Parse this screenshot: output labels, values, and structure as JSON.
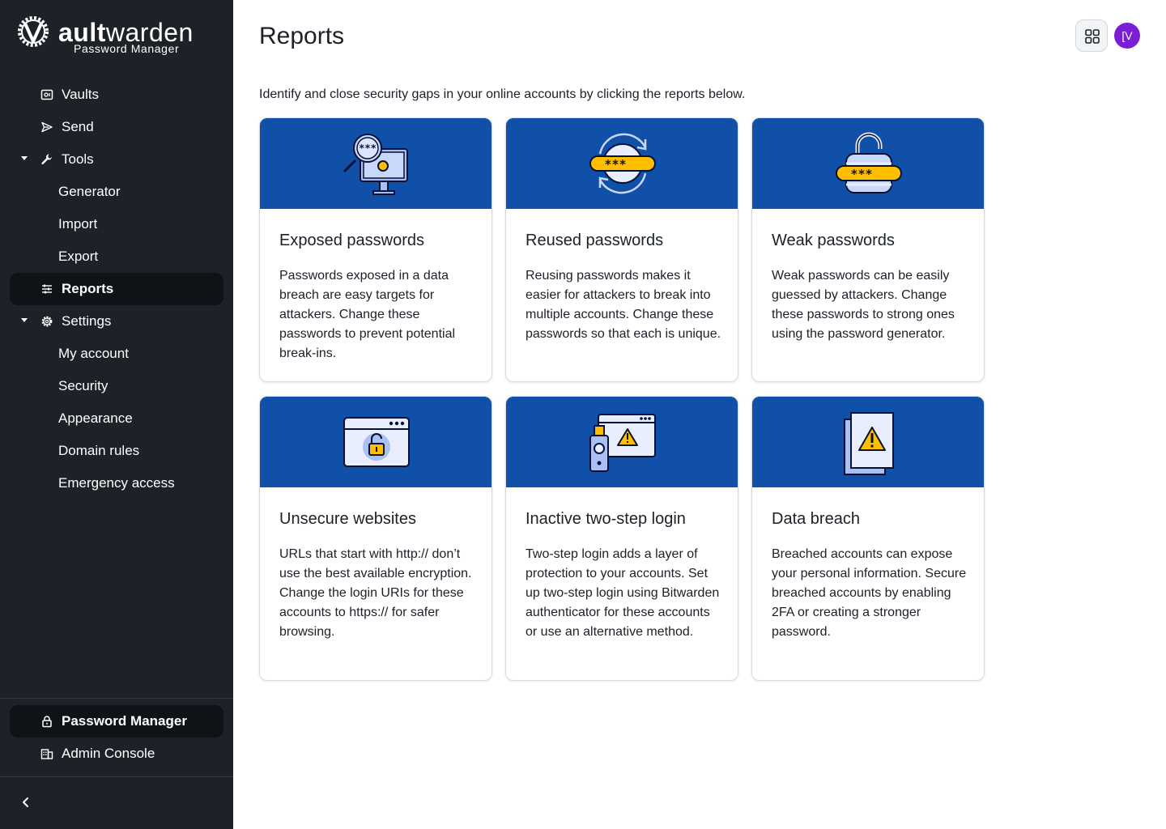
{
  "brand": {
    "name_prefix": "V",
    "name_bold": "ault",
    "name_rest": "warden",
    "subtitle": "Password Manager"
  },
  "sidebar": {
    "vaults": "Vaults",
    "send": "Send",
    "tools": "Tools",
    "generator": "Generator",
    "import": "Import",
    "export": "Export",
    "reports": "Reports",
    "settings": "Settings",
    "my_account": "My account",
    "security": "Security",
    "appearance": "Appearance",
    "domain_rules": "Domain rules",
    "emergency_access": "Emergency access",
    "password_manager": "Password Manager",
    "admin_console": "Admin Console"
  },
  "header": {
    "title": "Reports",
    "avatar_initials": "[V"
  },
  "intro": "Identify and close security gaps in your online accounts by clicking the reports below.",
  "reports": [
    {
      "title": "Exposed passwords",
      "description": "Passwords exposed in a data breach are easy targets for attackers. Change these passwords to prevent potential break-ins."
    },
    {
      "title": "Reused passwords",
      "description": "Reusing passwords makes it easier for attackers to break into multiple accounts. Change these passwords so that each is unique."
    },
    {
      "title": "Weak passwords",
      "description": "Weak passwords can be easily guessed by attackers. Change these passwords to strong ones using the password generator."
    },
    {
      "title": "Unsecure websites",
      "description": "URLs that start with http:// don’t use the best available encryption. Change the login URIs for these accounts to https:// for safer browsing."
    },
    {
      "title": "Inactive two-step login",
      "description": "Two-step login adds a layer of protection to your accounts. Set up two-step login using Bitwarden authenticator for these accounts or use an alternative method."
    },
    {
      "title": "Data breach",
      "description": "Breached accounts can expose your personal information. Secure breached accounts by enabling 2FA or creating a stronger password."
    }
  ],
  "icons": {
    "password_mask": "***__"
  }
}
